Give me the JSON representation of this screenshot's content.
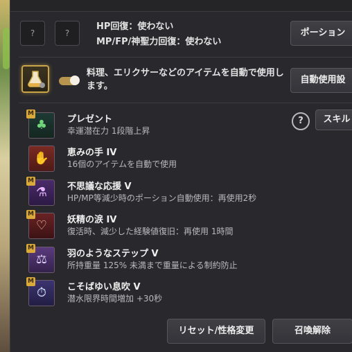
{
  "potion": {
    "slot1_label": "?",
    "slot2_label": "?",
    "hp_line": "HP回復：使わない",
    "mp_line": "MP/FP/神聖力回復：使わない",
    "potion_button": "ポーション"
  },
  "auto_use": {
    "toggle_on": true,
    "description": "料理、エリクサーなどのアイテムを自動で使用します。",
    "button": "自動使用設"
  },
  "help_label": "?",
  "skill_button": "スキル",
  "buffs": [
    {
      "badge": "M",
      "name": "プレゼント",
      "desc": "幸運潜在力 1段階上昇",
      "icon": "clover-icon",
      "badge_visible": true
    },
    {
      "badge": "",
      "name": "恵みの手 IV",
      "desc": "16個のアイテムを自動で使用",
      "icon": "fairy-hand-icon",
      "badge_visible": false
    },
    {
      "badge": "M",
      "name": "不思議な応援 V",
      "desc": "HP/MP等減少時のポーション自動使用：再使用2秒",
      "icon": "potion-bottles-icon",
      "badge_visible": true
    },
    {
      "badge": "M",
      "name": "妖精の涙 IV",
      "desc": "復活時、減少した経験値復旧：再使用 1時間",
      "icon": "tear-vial-icon",
      "badge_visible": true
    },
    {
      "badge": "M",
      "name": "羽のようなステップ V",
      "desc": "所持重量 125% 未満まで重量による制約防止",
      "icon": "weight-feather-icon",
      "badge_visible": true
    },
    {
      "badge": "M",
      "name": "こそばゆい息吹 V",
      "desc": "潜水限界時間増加 +30秒",
      "icon": "bubbles-timer-icon",
      "badge_visible": true
    }
  ],
  "footer": {
    "reset_button": "リセット/性格変更",
    "dismiss_button": "召喚解除"
  }
}
